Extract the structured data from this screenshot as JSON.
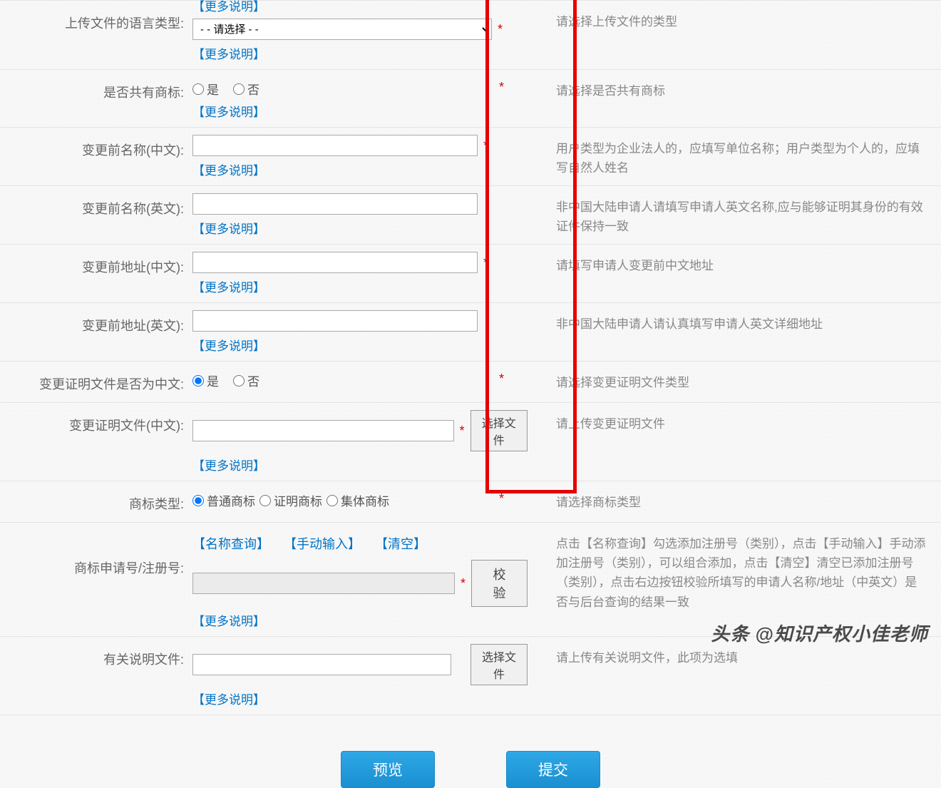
{
  "common": {
    "moreHelp": "【更多说明】",
    "required": "*",
    "selectFile": "选择文件"
  },
  "rows": {
    "langType": {
      "label": "上传文件的语言类型:",
      "selectPlaceholder": "- - 请选择 - -",
      "help": "请选择上传文件的类型"
    },
    "sharedTm": {
      "label": "是否共有商标:",
      "optYes": "是",
      "optNo": "否",
      "help": "请选择是否共有商标"
    },
    "nameBeforeCn": {
      "label": "变更前名称(中文):",
      "help": "用户类型为企业法人的，应填写单位名称；用户类型为个人的，应填写自然人姓名"
    },
    "nameBeforeEn": {
      "label": "变更前名称(英文):",
      "help": "非中国大陆申请人请填写申请人英文名称,应与能够证明其身份的有效证件保持一致"
    },
    "addrBeforeCn": {
      "label": "变更前地址(中文):",
      "help": "请填写申请人变更前中文地址"
    },
    "addrBeforeEn": {
      "label": "变更前地址(英文):",
      "help": "非中国大陆申请人请认真填写申请人英文详细地址"
    },
    "proofIsCn": {
      "label": "变更证明文件是否为中文:",
      "optYes": "是",
      "optNo": "否",
      "help": "请选择变更证明文件类型"
    },
    "proofFileCn": {
      "label": "变更证明文件(中文):",
      "help": "请上传变更证明文件"
    },
    "tmType": {
      "label": "商标类型:",
      "opt1": "普通商标",
      "opt2": "证明商标",
      "opt3": "集体商标",
      "help": "请选择商标类型"
    },
    "appNo": {
      "label": "商标申请号/注册号:",
      "linkQuery": "【名称查询】",
      "linkManual": "【手动输入】",
      "linkClear": "【清空】",
      "verify": "校验",
      "help": "点击【名称查询】勾选添加注册号（类别），点击【手动输入】手动添加注册号（类别），可以组合添加，点击【清空】清空已添加注册号（类别），点击右边按钮校验所填写的申请人名称/地址（中英文）是否与后台查询的结果一致"
    },
    "relatedDoc": {
      "label": "有关说明文件:",
      "help": "请上传有关说明文件，此项为选填"
    }
  },
  "footer": {
    "preview": "预览",
    "submit": "提交"
  },
  "watermark": {
    "prefix": "头条 ",
    "at": "@",
    "name": "知识产权小佳老师"
  }
}
